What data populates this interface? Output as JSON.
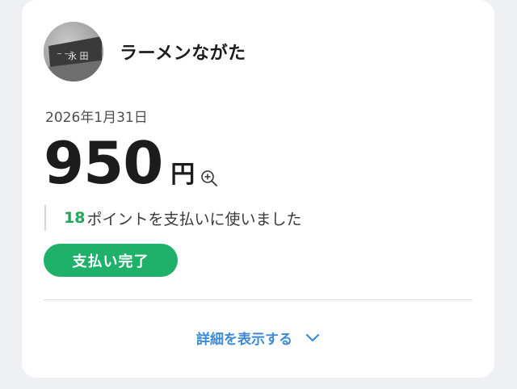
{
  "shop": {
    "name": "ラーメンながた",
    "avatar_icon": "shop-logo-sign"
  },
  "transaction": {
    "date": "2026年1月31日",
    "amount": "950",
    "currency": "円",
    "zoom_icon": "zoom-in-icon"
  },
  "points": {
    "count": "18",
    "text": "ポイントを支払いに使いました"
  },
  "status": {
    "label": "支払い完了",
    "color": "#1fb06a"
  },
  "details": {
    "label": "詳細を表示する",
    "icon": "chevron-down-icon",
    "color": "#3d8ad6"
  }
}
